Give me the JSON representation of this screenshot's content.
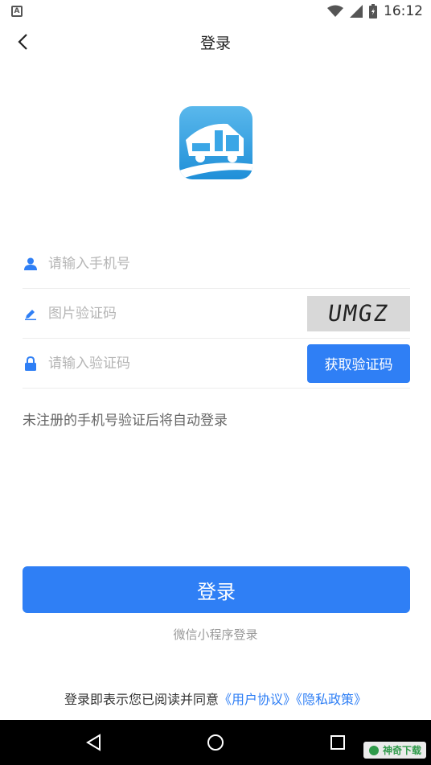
{
  "status_bar": {
    "time": "16:12",
    "left_icon_letter": "A"
  },
  "nav": {
    "title": "登录"
  },
  "form": {
    "phone_placeholder": "请输入手机号",
    "image_code_placeholder": "图片验证码",
    "captcha_text": "UMGZ",
    "sms_code_placeholder": "请输入验证码",
    "get_code_label": "获取验证码"
  },
  "hint": "未注册的手机号验证后将自动登录",
  "login_button": "登录",
  "wechat_login": "微信小程序登录",
  "agreement": {
    "prefix": "登录即表示您已阅读并同意",
    "user_agreement": "《用户协议》",
    "privacy_policy": "《隐私政策》"
  },
  "watermark": "神奇下载",
  "colors": {
    "accent": "#2f7ff5",
    "logo_top": "#5ab8ec",
    "logo_bottom": "#1f8fd8"
  }
}
